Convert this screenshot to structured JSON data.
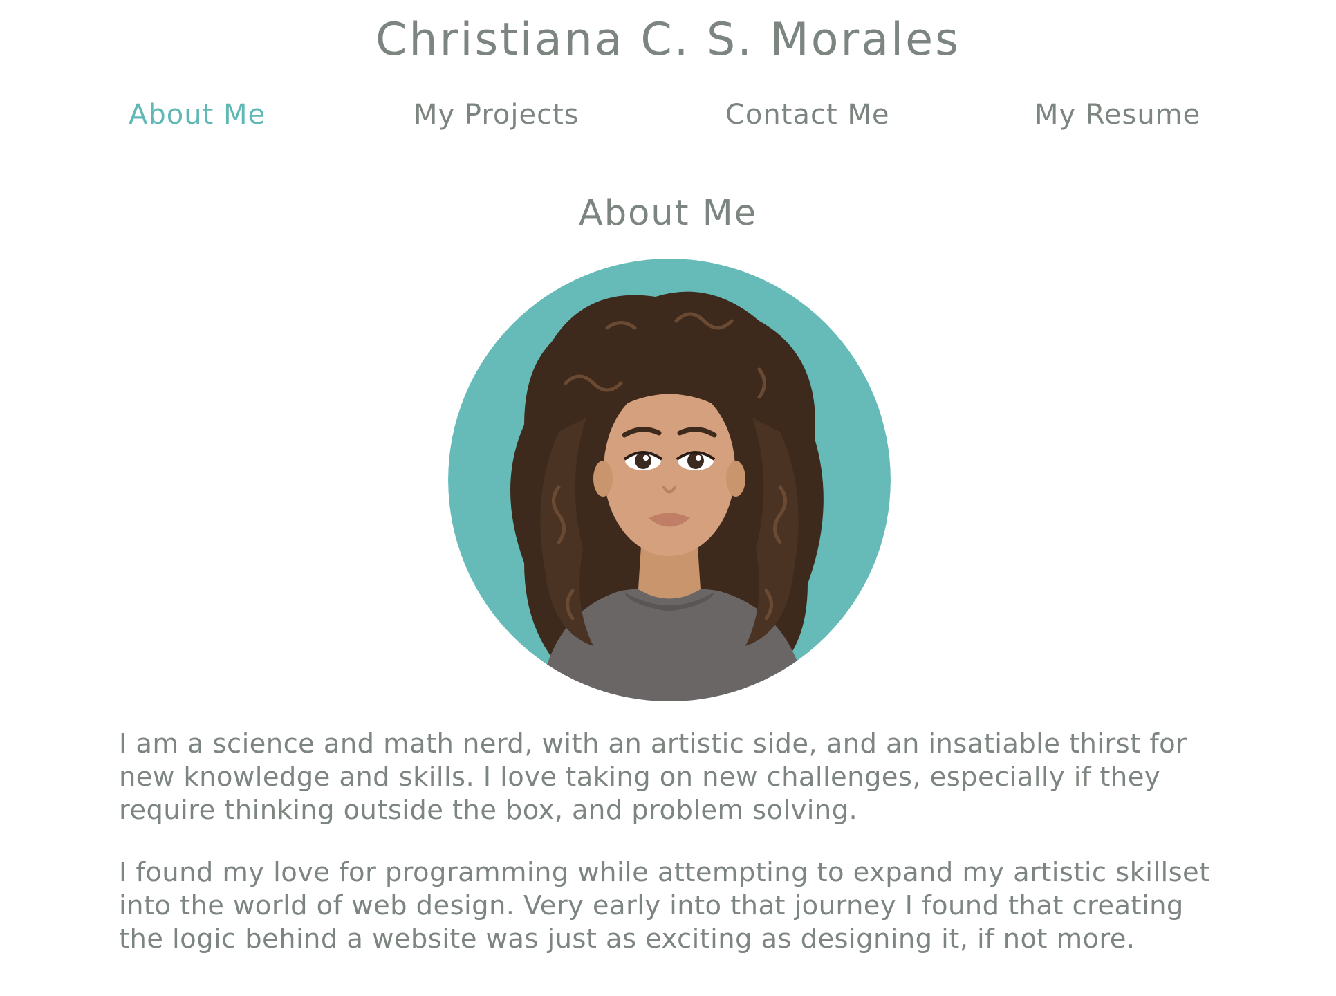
{
  "site": {
    "title": "Christiana C. S. Morales"
  },
  "nav": {
    "items": [
      {
        "label": "About Me",
        "active": true
      },
      {
        "label": "My Projects",
        "active": false
      },
      {
        "label": "Contact Me",
        "active": false
      },
      {
        "label": "My Resume",
        "active": false
      }
    ]
  },
  "about": {
    "heading": "About Me",
    "avatar_icon": "illustrated-portrait",
    "paragraphs": [
      "I am a science and math nerd, with an artistic side, and an insatiable thirst for new knowledge and skills. I love taking on new challenges, especially if they require thinking outside the box, and problem solving.",
      "I found my love for programming while attempting to expand my artistic skillset into the world of web design. Very early into that journey I found that creating the logic behind a website was just as exciting as designing it, if not more."
    ]
  },
  "colors": {
    "text": "#7d8580",
    "accent": "#5fb8b5",
    "avatar_bg": "#66bbb8"
  }
}
